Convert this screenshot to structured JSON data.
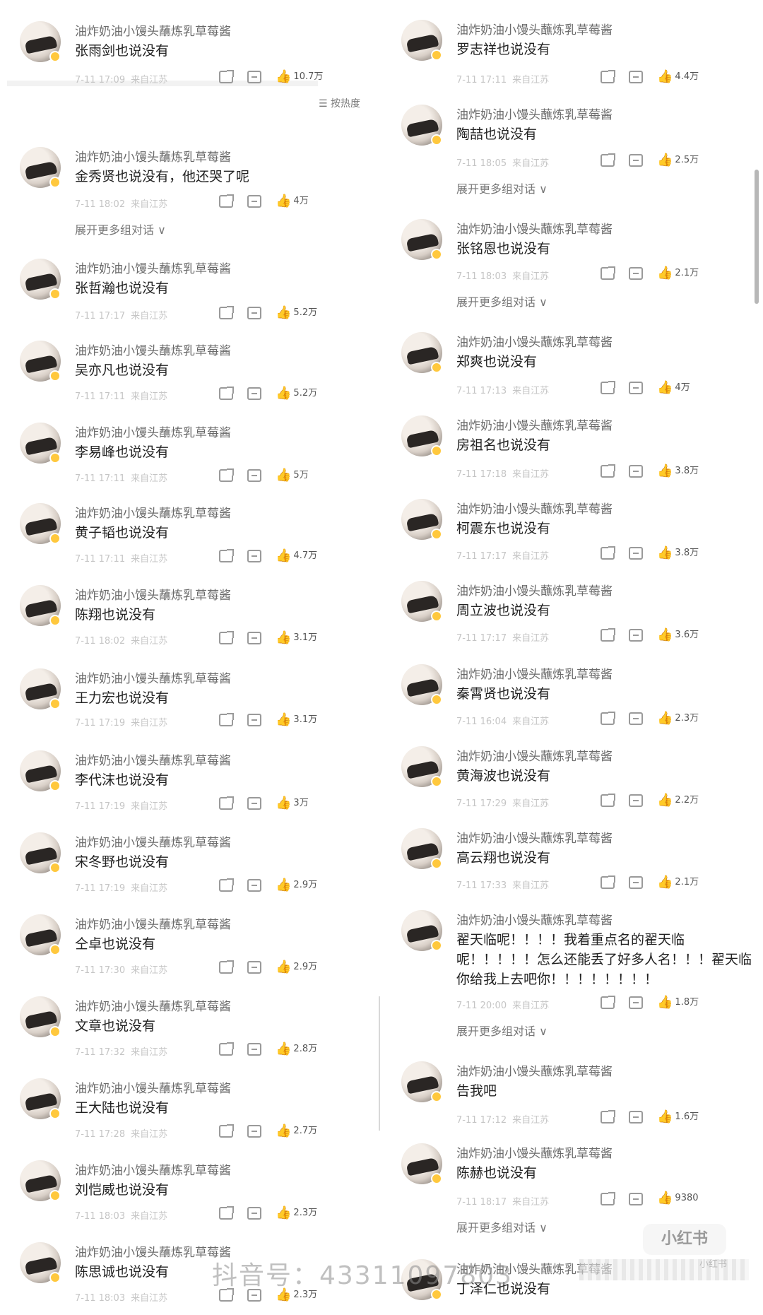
{
  "left": {
    "comments": [
      {
        "username": "油炸奶油小馒头蘸炼乳草莓酱",
        "text": "张雨剑也说没有",
        "time": "7-11 17:09",
        "location": "来自江苏",
        "likes": "10.7万",
        "hot": true
      },
      {
        "username": "油炸奶油小馒头蘸炼乳草莓酱",
        "text": "金秀贤也说没有，他还哭了呢",
        "time": "7-11 18:02",
        "location": "来自江苏",
        "likes": "4万",
        "hot": true
      },
      {
        "username": "油炸奶油小馒头蘸炼乳草莓酱",
        "text": "张哲瀚也说没有",
        "time": "7-11 17:17",
        "location": "来自江苏",
        "likes": "5.2万",
        "hot": true
      },
      {
        "username": "油炸奶油小馒头蘸炼乳草莓酱",
        "text": "吴亦凡也说没有",
        "time": "7-11 17:11",
        "location": "来自江苏",
        "likes": "5.2万",
        "hot": true
      },
      {
        "username": "油炸奶油小馒头蘸炼乳草莓酱",
        "text": "李易峰也说没有",
        "time": "7-11 17:11",
        "location": "来自江苏",
        "likes": "5万",
        "hot": true
      },
      {
        "username": "油炸奶油小馒头蘸炼乳草莓酱",
        "text": "黄子韬也说没有",
        "time": "7-11 17:11",
        "location": "来自江苏",
        "likes": "4.7万",
        "hot": true
      },
      {
        "username": "油炸奶油小馒头蘸炼乳草莓酱",
        "text": "陈翔也说没有",
        "time": "7-11 18:02",
        "location": "来自江苏",
        "likes": "3.1万",
        "hot": true
      },
      {
        "username": "油炸奶油小馒头蘸炼乳草莓酱",
        "text": "王力宏也说没有",
        "time": "7-11 17:19",
        "location": "来自江苏",
        "likes": "3.1万",
        "hot": true
      },
      {
        "username": "油炸奶油小馒头蘸炼乳草莓酱",
        "text": "李代沫也说没有",
        "time": "7-11 17:19",
        "location": "来自江苏",
        "likes": "3万",
        "hot": true
      },
      {
        "username": "油炸奶油小馒头蘸炼乳草莓酱",
        "text": "宋冬野也说没有",
        "time": "7-11 17:19",
        "location": "来自江苏",
        "likes": "2.9万",
        "hot": true
      },
      {
        "username": "油炸奶油小馒头蘸炼乳草莓酱",
        "text": "仝卓也说没有",
        "time": "7-11 17:30",
        "location": "来自江苏",
        "likes": "2.9万",
        "hot": false
      },
      {
        "username": "油炸奶油小馒头蘸炼乳草莓酱",
        "text": "文章也说没有",
        "time": "7-11 17:32",
        "location": "来自江苏",
        "likes": "2.8万",
        "hot": false
      },
      {
        "username": "油炸奶油小馒头蘸炼乳草莓酱",
        "text": "王大陆也说没有",
        "time": "7-11 17:28",
        "location": "来自江苏",
        "likes": "2.7万",
        "hot": false
      },
      {
        "username": "油炸奶油小馒头蘸炼乳草莓酱",
        "text": "刘恺威也说没有",
        "time": "7-11 18:03",
        "location": "来自江苏",
        "likes": "2.3万",
        "hot": false
      },
      {
        "username": "油炸奶油小馒头蘸炼乳草莓酱",
        "text": "陈思诚也说没有",
        "time": "7-11 18:03",
        "location": "来自江苏",
        "likes": "2.3万",
        "hot": false
      }
    ]
  },
  "right": {
    "comments": [
      {
        "username": "油炸奶油小馒头蘸炼乳草莓酱",
        "text": "罗志祥也说没有",
        "time": "7-11 17:11",
        "location": "来自江苏",
        "likes": "4.4万",
        "hot": true
      },
      {
        "username": "油炸奶油小馒头蘸炼乳草莓酱",
        "text": "陶喆也说没有",
        "time": "7-11 18:05",
        "location": "来自江苏",
        "likes": "2.5万",
        "hot": true
      },
      {
        "username": "油炸奶油小馒头蘸炼乳草莓酱",
        "text": "张铭恩也说没有",
        "time": "7-11 18:03",
        "location": "来自江苏",
        "likes": "2.1万",
        "hot": true
      },
      {
        "username": "油炸奶油小馒头蘸炼乳草莓酱",
        "text": "郑爽也说没有",
        "time": "7-11 17:13",
        "location": "来自江苏",
        "likes": "4万",
        "hot": true
      },
      {
        "username": "油炸奶油小馒头蘸炼乳草莓酱",
        "text": "房祖名也说没有",
        "time": "7-11 17:18",
        "location": "来自江苏",
        "likes": "3.8万",
        "hot": true
      },
      {
        "username": "油炸奶油小馒头蘸炼乳草莓酱",
        "text": "柯震东也说没有",
        "time": "7-11 17:17",
        "location": "来自江苏",
        "likes": "3.8万",
        "hot": true
      },
      {
        "username": "油炸奶油小馒头蘸炼乳草莓酱",
        "text": "周立波也说没有",
        "time": "7-11 17:17",
        "location": "来自江苏",
        "likes": "3.6万",
        "hot": true
      },
      {
        "username": "油炸奶油小馒头蘸炼乳草莓酱",
        "text": "秦霄贤也说没有",
        "time": "7-11 16:04",
        "location": "来自江苏",
        "likes": "2.3万",
        "hot": false
      },
      {
        "username": "油炸奶油小馒头蘸炼乳草莓酱",
        "text": "黄海波也说没有",
        "time": "7-11 17:29",
        "location": "来自江苏",
        "likes": "2.2万",
        "hot": false
      },
      {
        "username": "油炸奶油小馒头蘸炼乳草莓酱",
        "text": "高云翔也说没有",
        "time": "7-11 17:33",
        "location": "来自江苏",
        "likes": "2.1万",
        "hot": false
      },
      {
        "username": "油炸奶油小馒头蘸炼乳草莓酱",
        "text": "翟天临呢！！！！我着重点名的翟天临呢！！！！！怎么还能丢了好多人名！！！翟天临你给我上去吧你！！！！！！！！",
        "time": "7-11 20:00",
        "location": "来自江苏",
        "likes": "1.8万",
        "hot": true
      },
      {
        "username": "油炸奶油小馒头蘸炼乳草莓酱",
        "text": "告我吧",
        "time": "7-11 17:12",
        "location": "来自江苏",
        "likes": "1.6万",
        "hot": false
      },
      {
        "username": "油炸奶油小馒头蘸炼乳草莓酱",
        "text": "陈赫也说没有",
        "time": "7-11 18:17",
        "location": "来自江苏",
        "likes": "9380",
        "hot": false
      },
      {
        "username": "油炸奶油小馒头蘸炼乳草莓酱",
        "text": "丁泽仁也说没有",
        "time": "",
        "location": "",
        "likes": "",
        "hot": false
      }
    ]
  },
  "expand_label": "展开更多组对话 ∨",
  "sort_label": "按热度",
  "watermark": "抖音号：43311097803",
  "logo_text": "小红书",
  "logo_sub": "小红书"
}
